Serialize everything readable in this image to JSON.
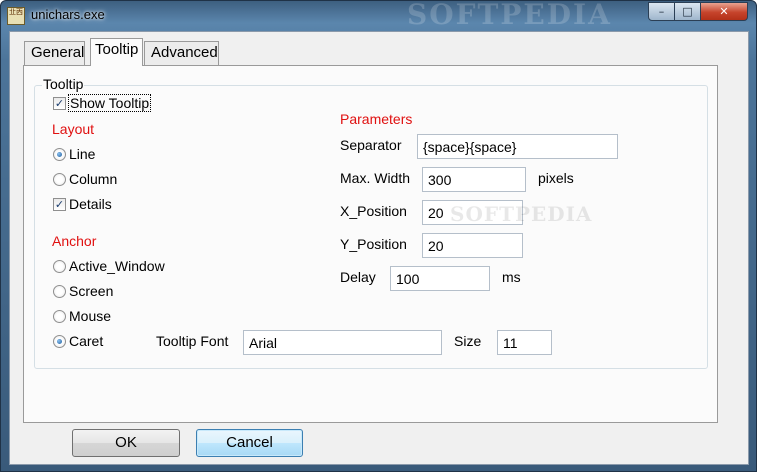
{
  "window": {
    "title": "unichars.exe",
    "icon_text": "㐀㐁",
    "watermark": "SOFTPEDIA",
    "buttons": {
      "minimize": "–",
      "maximize": "□",
      "close": "✕"
    }
  },
  "tabs": [
    {
      "label": "General",
      "selected": false
    },
    {
      "label": "Tooltip",
      "selected": true
    },
    {
      "label": "Advanced",
      "selected": false
    }
  ],
  "tooltip_group": {
    "legend": "Tooltip",
    "show_tooltip": {
      "label": "Show Tooltip",
      "checked": true
    },
    "layout": {
      "heading": "Layout",
      "options": [
        {
          "label": "Line",
          "type": "radio",
          "checked": true
        },
        {
          "label": "Column",
          "type": "radio",
          "checked": false
        },
        {
          "label": "Details",
          "type": "checkbox",
          "checked": true
        }
      ]
    },
    "anchor": {
      "heading": "Anchor",
      "options": [
        {
          "label": "Active_Window",
          "checked": false
        },
        {
          "label": "Screen",
          "checked": false
        },
        {
          "label": "Mouse",
          "checked": false
        },
        {
          "label": "Caret",
          "checked": true
        }
      ]
    },
    "parameters": {
      "heading": "Parameters",
      "separator": {
        "label": "Separator",
        "value": "{space}{space}"
      },
      "max_width": {
        "label": "Max. Width",
        "value": "300",
        "unit": "pixels"
      },
      "x_position": {
        "label": "X_Position",
        "value": "20"
      },
      "y_position": {
        "label": "Y_Position",
        "value": "20"
      },
      "delay": {
        "label": "Delay",
        "value": "100",
        "unit": "ms"
      }
    },
    "font": {
      "label": "Tooltip Font",
      "value": "Arial",
      "size_label": "Size",
      "size_value": "11"
    }
  },
  "dialog_buttons": {
    "ok": "OK",
    "cancel": "Cancel"
  },
  "colors": {
    "heading_red": "#e01010",
    "title_bar": "#4c7499",
    "focus_button": "#bee6fd"
  }
}
